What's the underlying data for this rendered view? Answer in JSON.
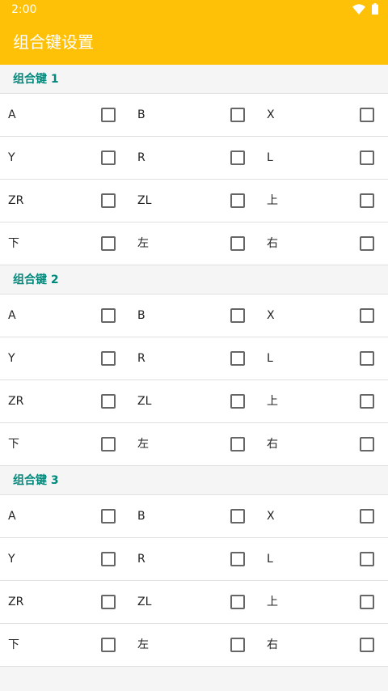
{
  "status_bar": {
    "time": "2:00",
    "icons": [
      "wifi-icon",
      "battery-icon"
    ]
  },
  "app_bar": {
    "title": "组合键设置"
  },
  "colors": {
    "accent": "#ffc107",
    "group_title": "#00897b",
    "checkbox_border": "#666666"
  },
  "groups": [
    {
      "title": "组合键 1",
      "rows": [
        [
          {
            "key": "A",
            "checked": false
          },
          {
            "key": "B",
            "checked": false
          },
          {
            "key": "X",
            "checked": false
          }
        ],
        [
          {
            "key": "Y",
            "checked": false
          },
          {
            "key": "R",
            "checked": false
          },
          {
            "key": "L",
            "checked": false
          }
        ],
        [
          {
            "key": "ZR",
            "checked": false
          },
          {
            "key": "ZL",
            "checked": false
          },
          {
            "key": "上",
            "checked": false
          }
        ],
        [
          {
            "key": "下",
            "checked": false
          },
          {
            "key": "左",
            "checked": false
          },
          {
            "key": "右",
            "checked": false
          }
        ]
      ]
    },
    {
      "title": "组合键 2",
      "rows": [
        [
          {
            "key": "A",
            "checked": false
          },
          {
            "key": "B",
            "checked": false
          },
          {
            "key": "X",
            "checked": false
          }
        ],
        [
          {
            "key": "Y",
            "checked": false
          },
          {
            "key": "R",
            "checked": false
          },
          {
            "key": "L",
            "checked": false
          }
        ],
        [
          {
            "key": "ZR",
            "checked": false
          },
          {
            "key": "ZL",
            "checked": false
          },
          {
            "key": "上",
            "checked": false
          }
        ],
        [
          {
            "key": "下",
            "checked": false
          },
          {
            "key": "左",
            "checked": false
          },
          {
            "key": "右",
            "checked": false
          }
        ]
      ]
    },
    {
      "title": "组合键 3",
      "rows": [
        [
          {
            "key": "A",
            "checked": false
          },
          {
            "key": "B",
            "checked": false
          },
          {
            "key": "X",
            "checked": false
          }
        ],
        [
          {
            "key": "Y",
            "checked": false
          },
          {
            "key": "R",
            "checked": false
          },
          {
            "key": "L",
            "checked": false
          }
        ],
        [
          {
            "key": "ZR",
            "checked": false
          },
          {
            "key": "ZL",
            "checked": false
          },
          {
            "key": "上",
            "checked": false
          }
        ],
        [
          {
            "key": "下",
            "checked": false
          },
          {
            "key": "左",
            "checked": false
          },
          {
            "key": "右",
            "checked": false
          }
        ]
      ]
    }
  ]
}
